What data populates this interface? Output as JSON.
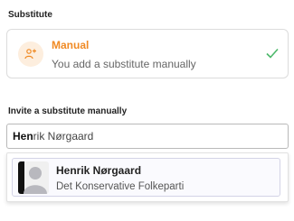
{
  "substitute": {
    "section_label": "Substitute",
    "selected_option": {
      "title": "Manual",
      "description": "You add a substitute manually",
      "icon": "add-user-icon",
      "status_icon": "check-icon"
    }
  },
  "invite": {
    "section_label": "Invite a substitute manually",
    "search_typed": "Hen",
    "search_autocomplete": "rik Nørgaard",
    "results": [
      {
        "name": "Henrik Nørgaard",
        "party": "Det Konservative Folkeparti",
        "icon": "person-avatar-icon"
      }
    ]
  },
  "colors": {
    "accent": "#f08a24",
    "accent_bg": "#fdeede",
    "check": "#4cb86a",
    "border": "#dcdcdc"
  }
}
